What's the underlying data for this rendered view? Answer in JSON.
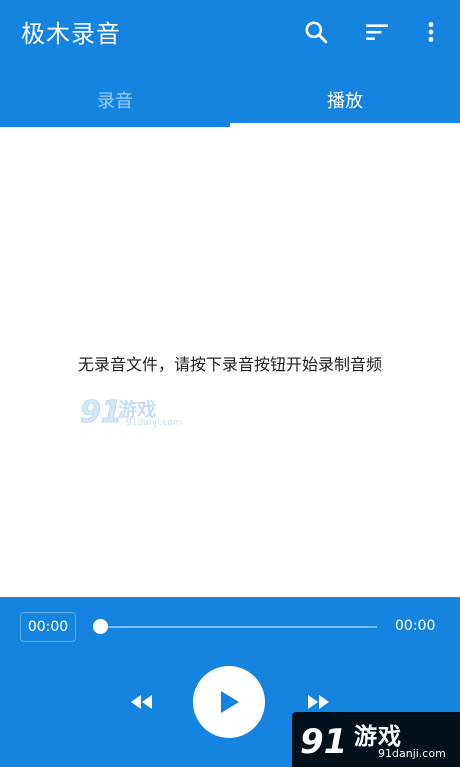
{
  "app": {
    "title": "极木录音",
    "primary_color": "#1584e0",
    "actions": [
      "search-icon",
      "sort-icon",
      "more-vert-icon"
    ]
  },
  "tabs": {
    "items": [
      {
        "label": "录音",
        "selected": false
      },
      {
        "label": "播放",
        "selected": true
      }
    ]
  },
  "content": {
    "empty_message": "无录音文件，请按下录音按钮开始录制音频",
    "watermark_text": "游戏",
    "watermark_sub": "91danji.com"
  },
  "player": {
    "current_time": "00:00",
    "total_time": "00:00",
    "progress": 0,
    "controls": [
      "rewind-icon",
      "play-icon",
      "fast-forward-icon"
    ]
  },
  "overlay_logo": {
    "text": "游戏",
    "sub": "91danji.com"
  }
}
